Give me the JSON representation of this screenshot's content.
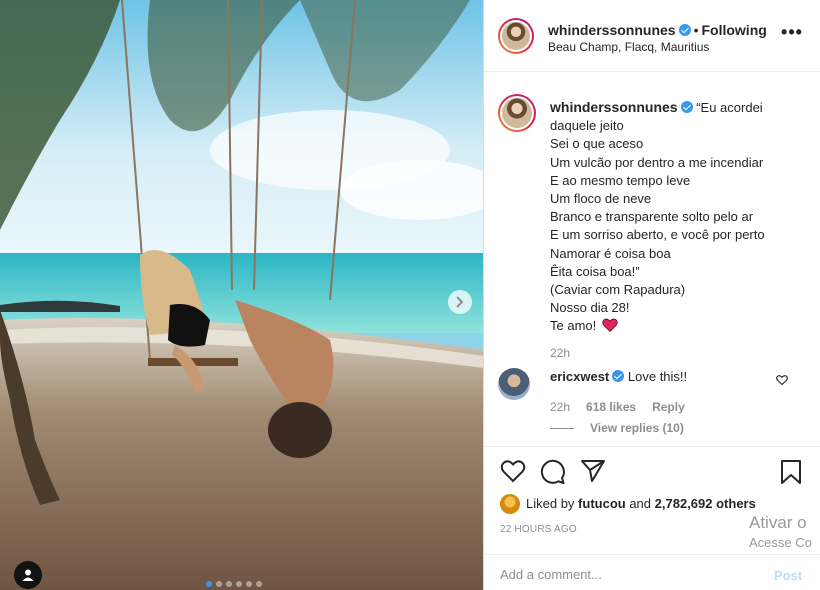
{
  "post": {
    "username": "whinderssonnunes",
    "follow_state": "Following",
    "location": "Beau Champ, Flacq, Mauritius",
    "more_label": "•••"
  },
  "caption": {
    "username": "whinderssonnunes",
    "text": "“Eu acordei daquele jeito\nSei o que aceso\nUm vulcão por dentro a me incendiar\nE ao mesmo tempo leve\nUm floco de neve\nBranco e transparente solto pelo ar\nE um sorriso aberto, e você por perto\nNamorar é coisa boa\nÊita coisa boa!”\n(Caviar com Rapadura)\nNosso dia 28!\nTe amo!",
    "emoji": "red-heart",
    "time": "22h"
  },
  "comments": [
    {
      "username": "ericxwest",
      "text": "Love this!!",
      "time": "22h",
      "likes": "618 likes",
      "reply_label": "Reply",
      "view_replies": "View replies (10)"
    }
  ],
  "likes": {
    "prefix": "Liked by",
    "user": "futucou",
    "middle": "and",
    "others": "2,782,692 others"
  },
  "timestamp": "22 HOURS AGO",
  "add_comment": {
    "placeholder": "Add a comment...",
    "post_label": "Post"
  },
  "watermark": {
    "line1": "Ativar o",
    "line2": "Acesse Co"
  },
  "carousel": {
    "total": 6,
    "active": 1
  },
  "colors": {
    "verified": "#3897f0",
    "post_button_disabled": "#b2dffc",
    "heart": "#ed4956"
  }
}
